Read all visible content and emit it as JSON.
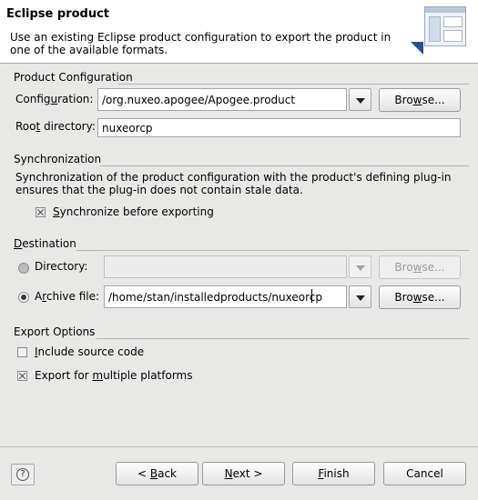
{
  "banner": {
    "title": "Eclipse product",
    "description": "Use an existing Eclipse product configuration to export the product in one of the available formats."
  },
  "product_config": {
    "group_title": "Product Configuration",
    "configuration_label_pre": "Config",
    "configuration_label_u": "u",
    "configuration_label_post": "ration:",
    "configuration_value": "/org.nuxeo.apogee/Apogee.product",
    "browse_pre": "Bro",
    "browse_u": "w",
    "browse_post": "se...",
    "root_label_pre": "Roo",
    "root_label_u": "t",
    "root_label_post": " directory:",
    "root_value": "nuxeorcp"
  },
  "synchronization": {
    "group_title": "Synchronization",
    "description": "Synchronization of the product configuration with the product's defining plug-in ensures that the plug-in does not contain stale data.",
    "checkbox_u": "S",
    "checkbox_post": "ynchronize before exporting",
    "checked": true
  },
  "destination": {
    "group_title_u": "D",
    "group_title_post": "estination",
    "directory_label": "Directory:",
    "directory_value": "",
    "directory_selected": false,
    "archive_label_pre": "A",
    "archive_label_u": "r",
    "archive_label_post": "chive file:",
    "archive_value": "/home/stan/installedproducts/nuxeorcp",
    "archive_selected": true,
    "browse_pre": "Bro",
    "browse_u": "w",
    "browse_post": "se..."
  },
  "export_options": {
    "group_title": "Export Options",
    "include_source_u": "I",
    "include_source_post": "nclude source code",
    "include_source_checked": false,
    "multi_platform_pre": "Export for ",
    "multi_platform_u": "m",
    "multi_platform_post": "ultiple platforms",
    "multi_platform_checked": true
  },
  "footer": {
    "help_glyph": "?",
    "back_pre": "< ",
    "back_u": "B",
    "back_post": "ack",
    "next_u": "N",
    "next_post": "ext >",
    "finish_u": "F",
    "finish_post": "inish",
    "cancel": "Cancel"
  },
  "colors": {
    "dialog_bg": "#e8e8e7",
    "banner_bg": "#ffffff",
    "banner_accent": "#2a4f8c"
  }
}
